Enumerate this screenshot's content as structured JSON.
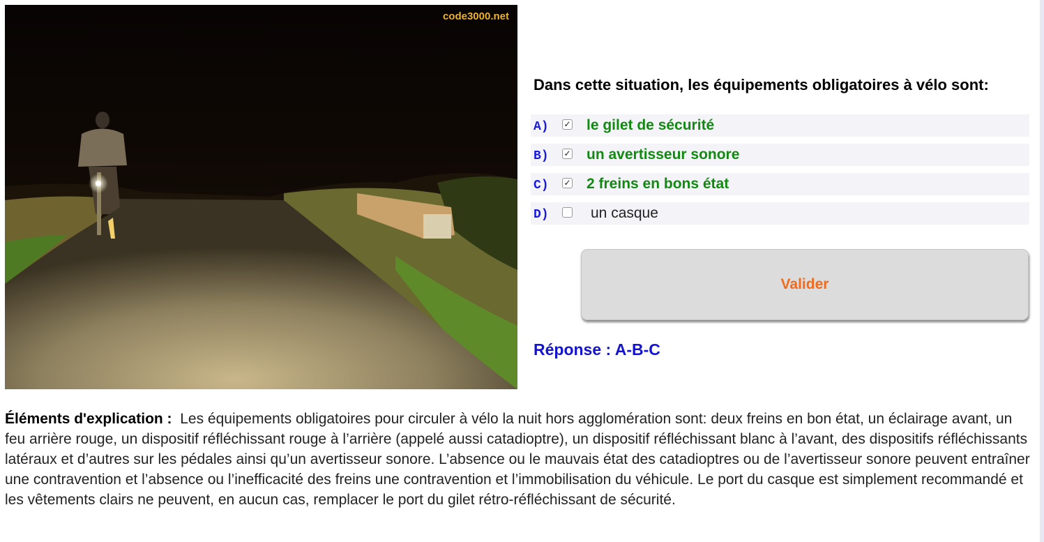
{
  "photo": {
    "watermark": "code3000.net"
  },
  "question": {
    "text": "Dans cette situation, les équipements obligatoires à vélo sont:",
    "options": [
      {
        "letter": "A)",
        "label": "le gilet de sécurité",
        "checked": true,
        "correct": true
      },
      {
        "letter": "B)",
        "label": "un avertisseur sonore",
        "checked": true,
        "correct": true
      },
      {
        "letter": "C)",
        "label": "2 freins en bons état",
        "checked": true,
        "correct": true
      },
      {
        "letter": "D)",
        "label": "un casque",
        "checked": false,
        "correct": false
      }
    ]
  },
  "validate_label": "Valider",
  "answer_text": "Réponse : A-B-C",
  "explanation": {
    "lead": "Éléments d'explication :",
    "body": "Les équipements obligatoires pour circuler à vélo la nuit hors agglomération sont: deux freins en bon état, un éclairage avant, un feu arrière rouge, un dispositif réfléchissant rouge à l’arrière (appelé aussi catadioptre), un dispositif réfléchissant blanc à l’avant, des dispositifs réfléchissants latéraux et d’autres sur les pédales ainsi qu’un avertisseur sonore. L’absence ou le mauvais état des catadioptres ou de l’avertisseur sonore peuvent entraîner une contravention et l’absence ou l’inefficacité des freins une contravention et l’immobilisation du véhicule. Le port du casque est simplement recommandé et les vêtements clairs ne peuvent, en aucun cas, remplacer le port du gilet rétro-réfléchissant de sécurité."
  },
  "colors": {
    "correct": "#128a12",
    "letter": "#1a1adf",
    "validate_text": "#f26a1b",
    "answer": "#1313d0"
  }
}
